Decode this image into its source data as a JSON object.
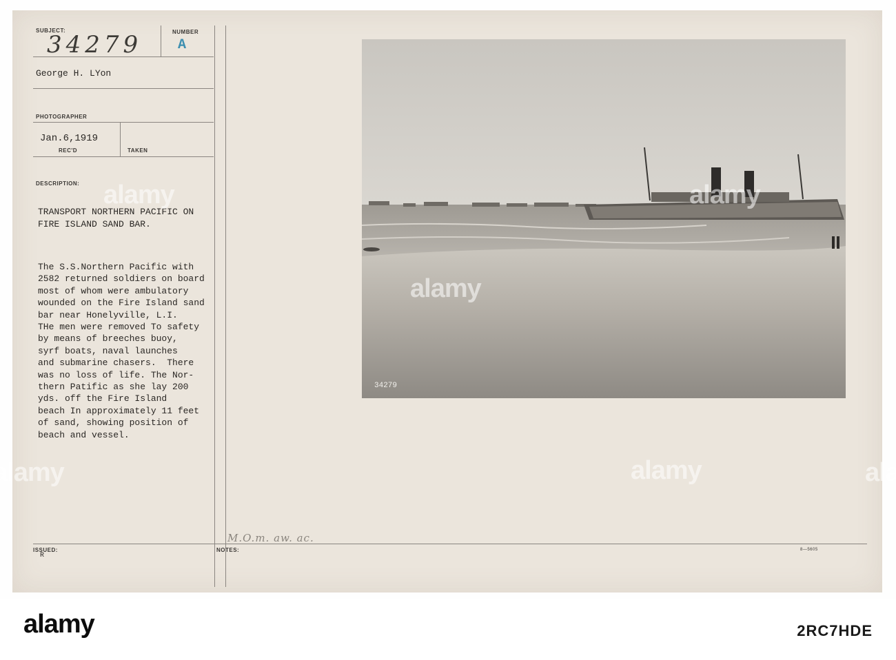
{
  "card": {
    "subject_label": "SUBJECT:",
    "subject_number": "34279",
    "number_label": "NUMBER",
    "number_value": "A",
    "photographer_name": "George H. LYon",
    "photographer_label": "PHOTOGRAPHER",
    "date_value": "Jan.6,1919",
    "recd_label": "REC'D",
    "taken_label": "TAKEN",
    "description_label": "DESCRIPTION:",
    "title_lines": [
      "TRANSPORT NORTHERN PACIFIC ON",
      "FIRE ISLAND SAND BAR."
    ],
    "body_lines": [
      "The S.S.Northern Pacific with",
      "2582 returned soldiers on board",
      "most of whom were ambulatory",
      "wounded on the Fire Island sand",
      "bar near Honelyville, L.I.",
      "THe men were removed To safety",
      "by means of breeches buoy,",
      "syrf boats, naval launches",
      "and submarine chasers.  There",
      "was no loss of life. The Nor-",
      "thern Patific as she lay 200",
      "yds. off the Fire Island",
      "beach In approximately 11 feet",
      "of sand, showing position of",
      "beach and vessel."
    ],
    "issued_label": "ISSUED:",
    "issued_mark": "R",
    "notes_label": "NOTES:",
    "notes_handwriting": "M.O.m. aw. ac.",
    "form_code": "8—5605",
    "photo_number": "34279"
  },
  "watermark": {
    "text": "alamy",
    "image_id": "2RC7HDE"
  }
}
